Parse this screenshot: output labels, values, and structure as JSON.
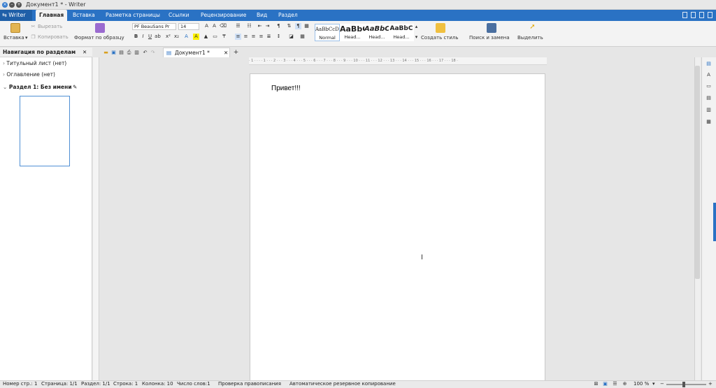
{
  "titlebar": {
    "title": "Документ1 * - Writer"
  },
  "menubar": {
    "app_label": "Writer",
    "tabs": [
      "Главная",
      "Вставка",
      "Разметка страницы",
      "Ссылки",
      "Рецензирование",
      "Вид",
      "Раздел"
    ]
  },
  "ribbon": {
    "paste": "Вставка",
    "cut": "Вырезать",
    "copy": "Копировать",
    "format_painter": "Формат по образцу",
    "font_name": "PF BeauSans Pr",
    "font_size": "14",
    "styles": [
      {
        "preview": "AaBbCcDd",
        "name": "Normal"
      },
      {
        "preview": "AaBbC",
        "name": "Head..."
      },
      {
        "preview": "AaBbC",
        "name": "Head..."
      },
      {
        "preview": "AaBbC",
        "name": "Head..."
      }
    ],
    "create_style": "Создать стиль",
    "find_replace": "Поиск и замена",
    "select": "Выделить"
  },
  "nav": {
    "header": "Навигация по разделам",
    "items": [
      "Титульный лист (нет)",
      "Оглавление (нет)",
      "Раздел 1: Без имени"
    ]
  },
  "doc": {
    "tab_name": "Документ1 *",
    "text": "Привет!!!"
  },
  "ruler": {
    "marks": "· 1 · ·  · · 1 · · · 2 · · · 3 · · · 4 · · · 5 · · · 6 · · · 7 · · · 8 · · · 9 · · · 10 · · · 11 · · · 12 · · · 13 · · · 14 · · · 15 · · · 16 · · · 17 · · · 18 ·"
  },
  "status": {
    "page_no": "Номер стр.: 1",
    "pages": "Страница: 1/1",
    "section": "Раздел: 1/1",
    "line": "Строка: 1",
    "column": "Колонка: 10",
    "words": "Число слов:1",
    "spellcheck": "Проверка правописания",
    "autosave": "Автоматическое резервное копирование",
    "zoom": "100 %"
  }
}
